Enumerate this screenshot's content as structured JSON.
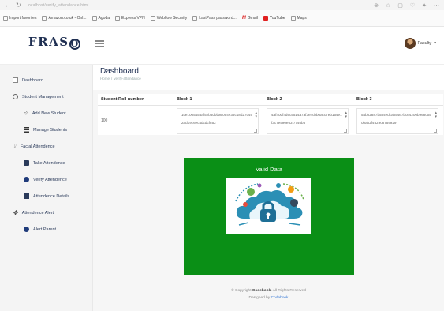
{
  "browser": {
    "url": "localhost/verify_attendance.html",
    "bookmarks": [
      "Import favorites",
      "Amazon.co.uk - Onl...",
      "Agoda",
      "Express VPN",
      "Webflow Security",
      "LastPass password...",
      "Gmail",
      "YouTube",
      "Maps"
    ]
  },
  "header": {
    "logo_prefix": "FRAS",
    "logo_o": "O",
    "user_label": "Faculty"
  },
  "sidebar": {
    "items": [
      {
        "label": "Dashboard",
        "icon": "dashboard-icon"
      },
      {
        "label": "Student Management",
        "icon": "gear-icon"
      },
      {
        "label": "Add New Student",
        "icon": "add-user-icon"
      },
      {
        "label": "Manage Students",
        "icon": "list-icon"
      },
      {
        "label": "Facial Attendence",
        "icon": "face-icon"
      },
      {
        "label": "Take Attendence",
        "icon": "camera-icon"
      },
      {
        "label": "Verify Attendence",
        "icon": "dot-icon"
      },
      {
        "label": "Attendence Details",
        "icon": "book-icon"
      },
      {
        "label": "Attendence Alert",
        "icon": "alert-icon"
      },
      {
        "label": "Alert Parent",
        "icon": "dot-icon"
      }
    ]
  },
  "page": {
    "title": "Dashboard",
    "breadcrumb": [
      "Home",
      "verify-attendance"
    ]
  },
  "table": {
    "headers": [
      "Student Roll number",
      "Block 1",
      "Block 2",
      "Block 3"
    ],
    "rows": [
      {
        "roll": "100",
        "block1": "1ce1065456af52b6d0ba6054e35c18d27c492ad19c6ec4dcdcf852",
        "block2": "4af40df4d9c5514a7af3e4cbb6acc7eb154e1f3c7e590e53f7746b5",
        "block3": "54bb2887b584edcab54e7bce4200b968c550bab2f4629c8769929"
      }
    ]
  },
  "result": {
    "title": "Valid Data"
  },
  "footer": {
    "copyright_prefix": "© Copyright",
    "brand": "Codebook",
    "copyright_suffix": "All Rights Reserved",
    "designed_prefix": "Designed by",
    "designed_brand": "Codebook"
  },
  "colors": {
    "valid_green": "#0a8f16",
    "brand_navy": "#1f2f52"
  }
}
